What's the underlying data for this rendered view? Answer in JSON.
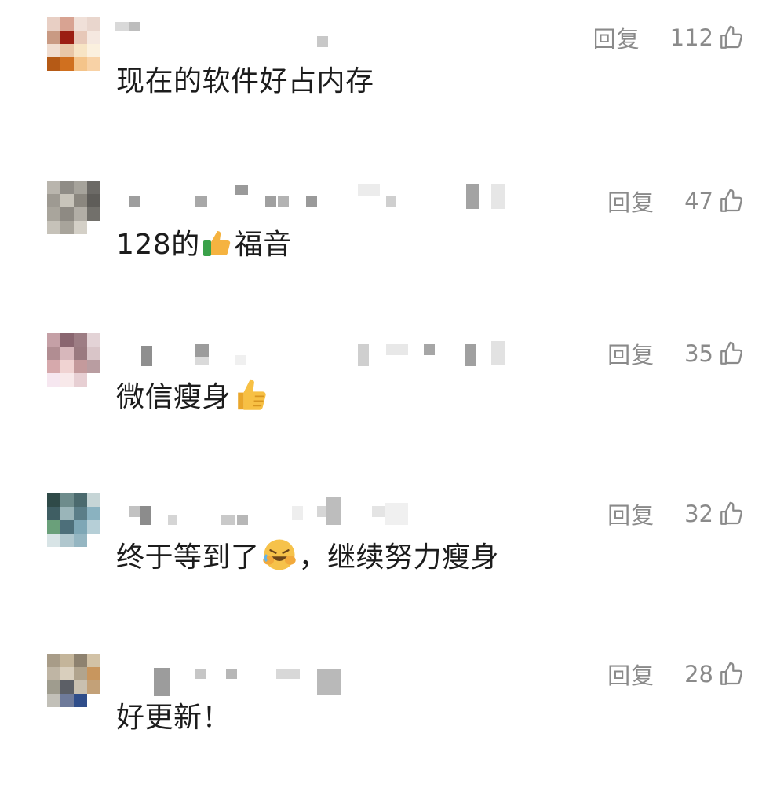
{
  "labels": {
    "reply": "回复"
  },
  "comments": [
    {
      "id": 1,
      "text": "现在的软件好占内存",
      "likes": "112"
    },
    {
      "id": 2,
      "text_before": "128的",
      "emoji": "thumbs-up-green-sleeve",
      "text_after": "福音",
      "likes": "47"
    },
    {
      "id": 3,
      "text_before": "微信瘦身",
      "emoji": "thumbs-up",
      "text_after": "",
      "likes": "35"
    },
    {
      "id": 4,
      "text_before": "终于等到了",
      "emoji": "rolling-laughing-face",
      "text_after": "，继续努力瘦身",
      "likes": "32"
    },
    {
      "id": 5,
      "text": "好更新！",
      "likes": "28"
    }
  ],
  "colors": {
    "text": "#1c1c1c",
    "muted": "#8a8a8a",
    "background": "#ffffff"
  },
  "icons": {
    "like": "thumbs-up-outline-icon"
  }
}
